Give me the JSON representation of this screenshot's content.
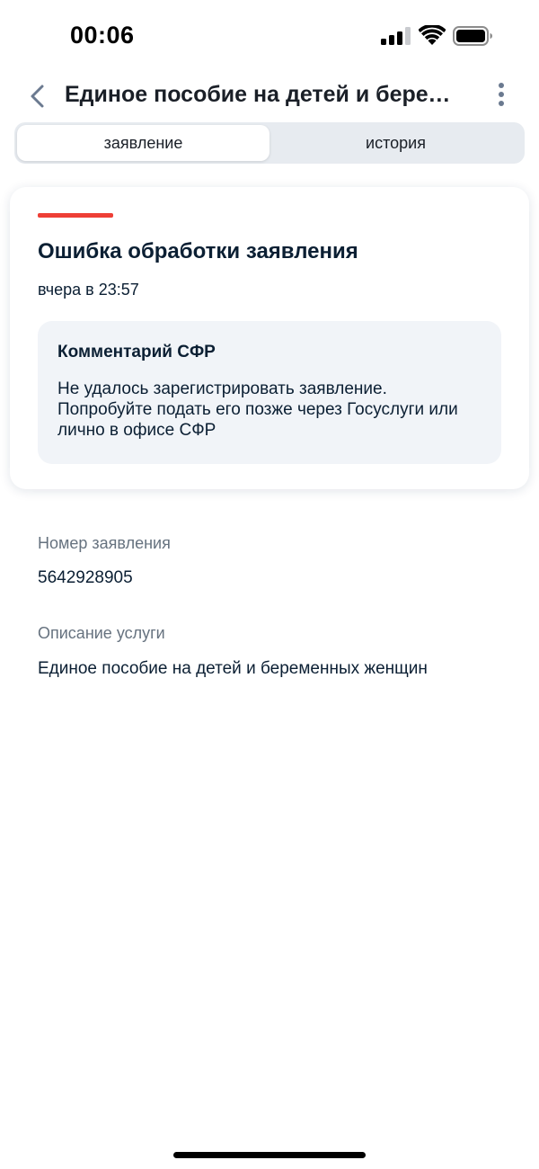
{
  "status_bar": {
    "time": "00:06"
  },
  "header": {
    "title": "Единое пособие на детей и беременных женщин"
  },
  "tabs": [
    {
      "label": "заявление",
      "active": true
    },
    {
      "label": "история",
      "active": false
    }
  ],
  "status_card": {
    "status_color": "#ee3f36",
    "title": "Ошибка обработки заявления",
    "time": "вчера в 23:57",
    "comment": {
      "title": "Комментарий СФР",
      "text": "Не удалось зарегистрировать заявление. Попробуйте подать его позже через Госуслуги или лично в офисе СФР"
    }
  },
  "details": {
    "application_number_label": "Номер заявления",
    "application_number": "5642928905",
    "service_description_label": "Описание услуги",
    "service_description": "Единое пособие на детей и беременных женщин"
  },
  "icons": {
    "back": "chevron-left-icon",
    "more": "more-vertical-icon",
    "signal": "cellular-signal-icon",
    "wifi": "wifi-icon",
    "battery": "battery-icon"
  }
}
